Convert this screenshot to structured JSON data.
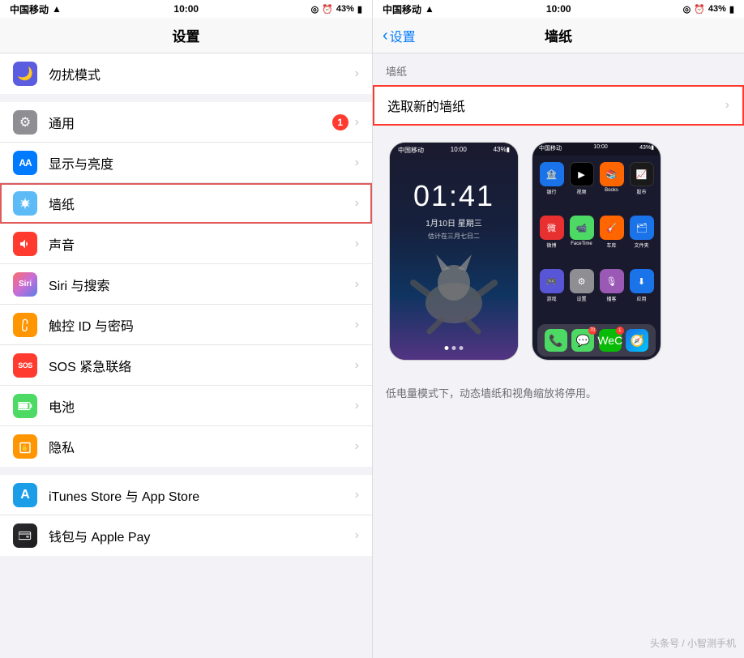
{
  "left": {
    "status": {
      "carrier": "中国移动",
      "time": "10:00",
      "battery": "43%"
    },
    "nav_title": "设置",
    "sections": [
      {
        "items": [
          {
            "id": "dnd",
            "icon_color": "icon-dnd",
            "icon_char": "🌙",
            "label": "勿扰模式",
            "badge": null
          }
        ]
      },
      {
        "items": [
          {
            "id": "general",
            "icon_color": "icon-general",
            "icon_char": "⚙",
            "label": "通用",
            "badge": "1"
          },
          {
            "id": "display",
            "icon_color": "icon-display",
            "icon_char": "AA",
            "label": "显示与亮度",
            "badge": null
          },
          {
            "id": "wallpaper",
            "icon_color": "icon-wallpaper",
            "icon_char": "✿",
            "label": "墙纸",
            "badge": null,
            "active": true
          },
          {
            "id": "sounds",
            "icon_color": "icon-sounds",
            "icon_char": "🔔",
            "label": "声音",
            "badge": null
          },
          {
            "id": "siri",
            "icon_color": "icon-siri",
            "icon_char": "◉",
            "label": "Siri 与搜索",
            "badge": null
          },
          {
            "id": "touch",
            "icon_color": "icon-touch",
            "icon_char": "◎",
            "label": "触控 ID 与密码",
            "badge": null
          },
          {
            "id": "sos",
            "icon_color": "icon-sos",
            "icon_char": "SOS",
            "label": "SOS 紧急联络",
            "badge": null
          },
          {
            "id": "battery",
            "icon_color": "icon-battery",
            "icon_char": "▬",
            "label": "电池",
            "badge": null
          },
          {
            "id": "privacy",
            "icon_color": "icon-privacy",
            "icon_char": "✋",
            "label": "隐私",
            "badge": null
          }
        ]
      },
      {
        "items": [
          {
            "id": "itunes",
            "icon_color": "icon-itunes",
            "icon_char": "A",
            "label": "iTunes Store 与 App Store",
            "badge": null
          },
          {
            "id": "wallet",
            "icon_color": "icon-wallet",
            "icon_char": "≡",
            "label": "钱包与 Apple Pay",
            "badge": null
          }
        ]
      }
    ]
  },
  "right": {
    "status": {
      "carrier": "中国移动",
      "time": "10:00",
      "battery": "43%"
    },
    "nav_back": "设置",
    "nav_title": "墙纸",
    "section_label": "墙纸",
    "choose_label": "选取新的墙纸",
    "note": "低电量模式下，动态墙纸和视角缩放将停用。",
    "lock_time": "01:41",
    "lock_date": "1月10日 星期三",
    "lock_date2": "估计在三月七日二"
  },
  "watermark": "头条号 / 小智测手机"
}
